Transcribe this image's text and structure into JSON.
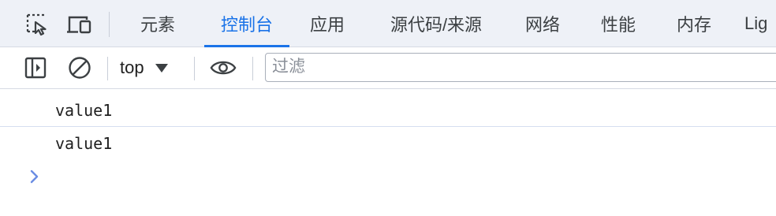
{
  "tabbar": {
    "icons": {
      "inspect": "inspect-element-icon",
      "device": "device-toolbar-icon"
    },
    "tabs": [
      {
        "label": "元素",
        "active": false
      },
      {
        "label": "控制台",
        "active": true
      },
      {
        "label": "应用",
        "active": false
      },
      {
        "label": "源代码/来源",
        "active": false
      },
      {
        "label": "网络",
        "active": false
      },
      {
        "label": "性能",
        "active": false
      },
      {
        "label": "内存",
        "active": false
      },
      {
        "label": "Lig",
        "active": false
      }
    ]
  },
  "toolbar": {
    "icons": {
      "sidebar": "show-sidebar-icon",
      "clear": "clear-console-icon",
      "live_expression": "eye-icon"
    },
    "context": "top",
    "filter_placeholder": "过滤"
  },
  "console": {
    "messages": [
      {
        "text": "value1"
      },
      {
        "text": "value1"
      }
    ],
    "prompt_icon": "chevron-right-icon"
  },
  "colors": {
    "accent": "#1a73e8",
    "tabbar_bg": "#eef1f7",
    "prompt": "#6b8de3"
  }
}
